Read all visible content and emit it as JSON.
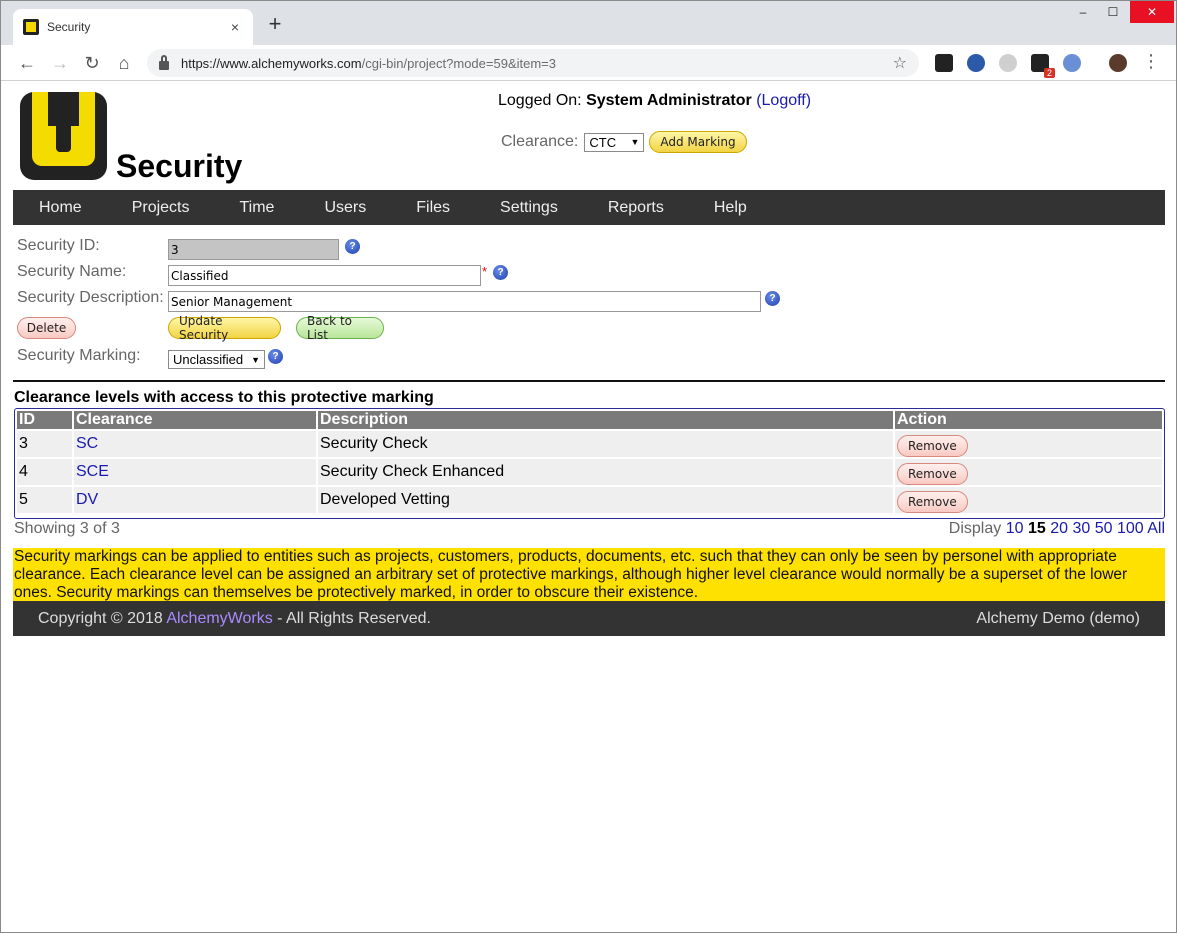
{
  "browser": {
    "tab_title": "Security",
    "tab_close": "×",
    "new_tab": "+",
    "url_host": "https://www.alchemyworks.com",
    "url_path": "/cgi-bin/project?mode=59&item=3",
    "win_min": "–",
    "win_max": "☐",
    "win_close": "✕",
    "ext_badge": "2"
  },
  "header": {
    "page_title": "Security",
    "logged_on_label": "Logged On:",
    "user_name": "System Administrator",
    "logoff_open": "(",
    "logoff_label": "Logoff",
    "logoff_close": ")",
    "clearance_label": "Clearance:",
    "clearance_value": "CTC",
    "add_marking_label": "Add Marking"
  },
  "nav": {
    "items": [
      "Home",
      "Projects",
      "Time",
      "Users",
      "Files",
      "Settings",
      "Reports",
      "Help"
    ]
  },
  "form": {
    "id_label": "Security ID:",
    "id_value": "3",
    "name_label": "Security Name:",
    "name_value": "Classified",
    "required_mark": "*",
    "desc_label": "Security Description:",
    "desc_value": "Senior Management",
    "delete_label": "Delete",
    "update_label": "Update Security",
    "back_label": "Back to List",
    "marking_label": "Security Marking:",
    "marking_value": "Unclassified",
    "help_glyph": "?"
  },
  "clearances": {
    "section_title": "Clearance levels with access to this protective marking",
    "columns": [
      "ID",
      "Clearance",
      "Description",
      "Action"
    ],
    "rows": [
      {
        "id": "3",
        "clearance": "SC",
        "description": "Security Check",
        "action": "Remove"
      },
      {
        "id": "4",
        "clearance": "SCE",
        "description": "Security Check Enhanced",
        "action": "Remove"
      },
      {
        "id": "5",
        "clearance": "DV",
        "description": "Developed Vetting",
        "action": "Remove"
      }
    ],
    "showing": "Showing 3 of 3",
    "display_label": "Display",
    "display_options": [
      "10",
      "15",
      "20",
      "30",
      "50",
      "100",
      "All"
    ]
  },
  "info_text": "Security markings can be applied to entities such as projects, customers, products, documents, etc. such that they can only be seen by personel with appropriate clearance. Each clearance level can be assigned an arbitrary set of protective markings, although higher level clearance would normally be a superset of the lower ones. Security markings can themselves be protectively marked, in order to obscure their existence.",
  "footer": {
    "copyright_prefix": "Copyright © 2018",
    "brand": "AlchemyWorks",
    "rights": "- All Rights Reserved.",
    "instance": "Alchemy Demo (demo)"
  },
  "colors": {
    "nav_bg": "#333333",
    "info_bg": "#ffe100",
    "link": "#1a1ab0",
    "brand_link": "#a98bff"
  }
}
